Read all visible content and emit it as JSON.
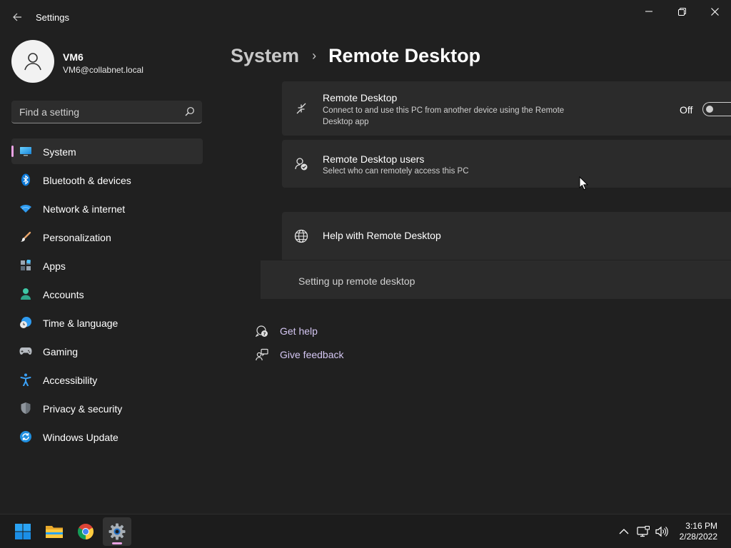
{
  "window": {
    "title": "Settings"
  },
  "profile": {
    "name": "VM6",
    "email": "VM6@collabnet.local"
  },
  "search": {
    "placeholder": "Find a setting"
  },
  "sidebar": {
    "items": [
      {
        "label": "System",
        "icon": "monitor-icon",
        "selected": true
      },
      {
        "label": "Bluetooth & devices",
        "icon": "bluetooth-icon"
      },
      {
        "label": "Network & internet",
        "icon": "wifi-icon"
      },
      {
        "label": "Personalization",
        "icon": "brush-icon"
      },
      {
        "label": "Apps",
        "icon": "apps-icon"
      },
      {
        "label": "Accounts",
        "icon": "person-icon"
      },
      {
        "label": "Time & language",
        "icon": "clock-globe-icon"
      },
      {
        "label": "Gaming",
        "icon": "gamepad-icon"
      },
      {
        "label": "Accessibility",
        "icon": "accessibility-icon"
      },
      {
        "label": "Privacy & security",
        "icon": "shield-icon"
      },
      {
        "label": "Windows Update",
        "icon": "update-icon"
      }
    ]
  },
  "breadcrumb": {
    "parent": "System",
    "separator": "›",
    "current": "Remote Desktop"
  },
  "remote_desktop": {
    "title": "Remote Desktop",
    "description": "Connect to and use this PC from another device using the Remote Desktop app",
    "toggle_state": "Off",
    "enabled": false
  },
  "remote_users": {
    "title": "Remote Desktop users",
    "description": "Select who can remotely access this PC"
  },
  "help": {
    "title": "Help with Remote Desktop",
    "link": "Setting up remote desktop"
  },
  "footer": {
    "get_help": "Get help",
    "give_feedback": "Give feedback"
  },
  "taskbar": {
    "apps": [
      "start-icon",
      "file-explorer-icon",
      "chrome-icon",
      "settings-icon"
    ],
    "time": "3:16 PM",
    "date": "2/28/2022"
  },
  "colors": {
    "background": "#202020",
    "card": "#2b2b2b",
    "accent": "#e9a2e3",
    "link": "#d4c6f2"
  }
}
